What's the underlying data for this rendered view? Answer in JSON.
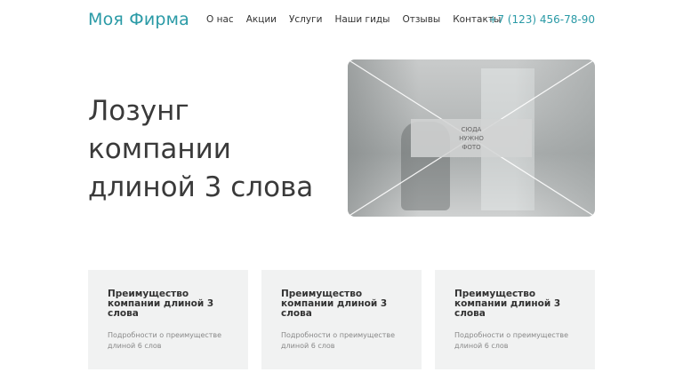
{
  "header": {
    "logo": "Моя Фирма",
    "nav": [
      "О нас",
      "Акции",
      "Услуги",
      "Наши гиды",
      "Отзывы",
      "Контакты"
    ],
    "phone": "+7 (123) 456-78-90"
  },
  "hero": {
    "slogan": "Лозунг компании длиной 3 слова",
    "photo_label_lines": [
      "СЮДА",
      "НУЖНО",
      "ФОТО"
    ]
  },
  "cards": [
    {
      "title": "Преимущество компании длиной 3 слова",
      "text": "Подробности о преимуществе длиной 6 слов"
    },
    {
      "title": "Преимущество компании длиной 3 слова",
      "text": "Подробности о преимуществе длиной 6 слов"
    },
    {
      "title": "Преимущество компании длиной 3 слова",
      "text": "Подробности о преимуществе длиной 6 слов"
    }
  ],
  "colors": {
    "accent": "#2a9aa6",
    "card_bg": "#f1f2f2"
  }
}
